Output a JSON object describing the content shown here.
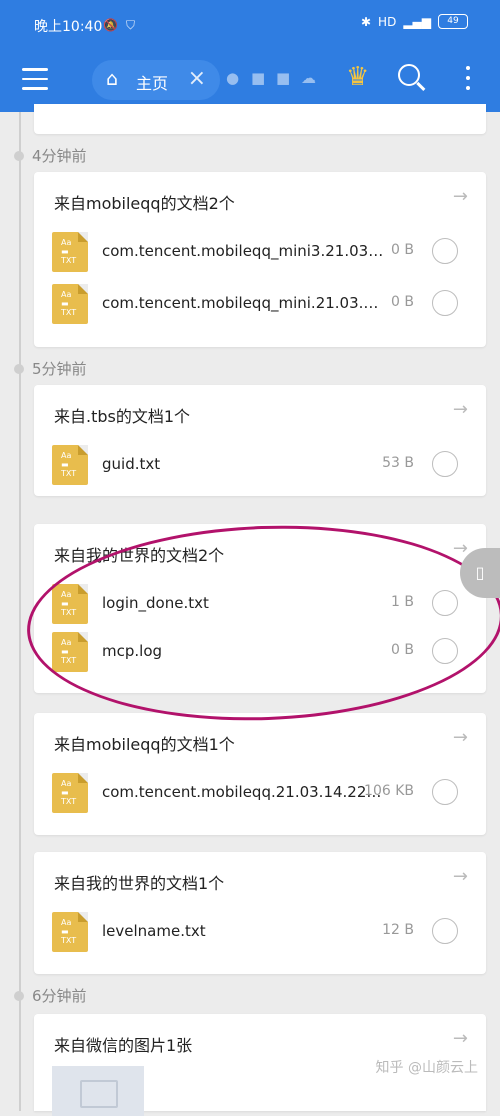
{
  "status_bar": {
    "time": "晚上10:40",
    "battery": "49"
  },
  "app_bar": {
    "tab_label": "主页"
  },
  "sections": [
    {
      "time_label": "4分钟前",
      "cards": [
        {
          "title": "来自mobileqq的文档2个",
          "files": [
            {
              "name": "com.tencent.mobileqq_mini3.21.03.14.…",
              "size": "0 B"
            },
            {
              "name": "com.tencent.mobileqq_mini.21.03.14.2…",
              "size": "0 B"
            }
          ]
        }
      ]
    },
    {
      "time_label": "5分钟前",
      "cards": [
        {
          "title": "来自.tbs的文档1个",
          "files": [
            {
              "name": "guid.txt",
              "size": "53 B"
            }
          ]
        },
        {
          "title": "来自我的世界的文档2个",
          "files": [
            {
              "name": "login_done.txt",
              "size": "1 B"
            },
            {
              "name": "mcp.log",
              "size": "0 B"
            }
          ]
        },
        {
          "title": "来自mobileqq的文档1个",
          "files": [
            {
              "name": "com.tencent.mobileqq.21.03.14.22.log",
              "size": "106 KB"
            }
          ]
        },
        {
          "title": "来自我的世界的文档1个",
          "files": [
            {
              "name": "levelname.txt",
              "size": "12 B"
            }
          ]
        }
      ]
    },
    {
      "time_label": "6分钟前",
      "cards": [
        {
          "title": "来自微信的图片1张"
        }
      ]
    }
  ],
  "watermark": "知乎 @山颜云上",
  "icons": {
    "file_icon_text": "TXT"
  }
}
